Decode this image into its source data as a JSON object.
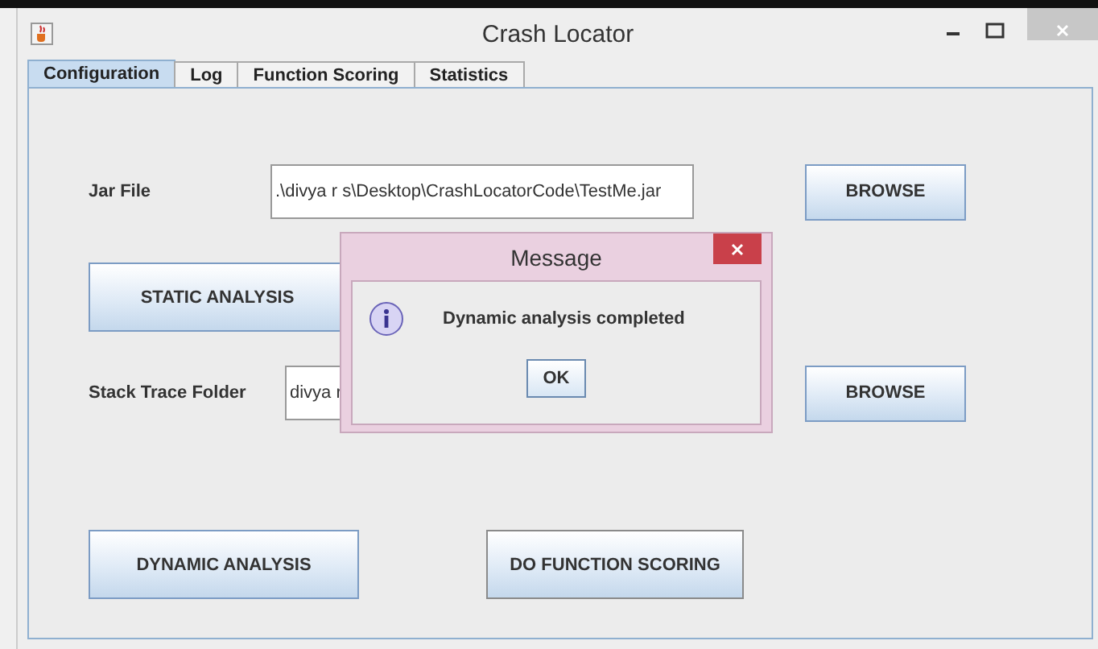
{
  "window": {
    "title": "Crash Locator"
  },
  "tabs": [
    {
      "label": "Configuration",
      "selected": true
    },
    {
      "label": "Log",
      "selected": false
    },
    {
      "label": "Function Scoring",
      "selected": false
    },
    {
      "label": "Statistics",
      "selected": false
    }
  ],
  "jar_file": {
    "label": "Jar File",
    "value": ".\\divya r s\\Desktop\\CrashLocatorCode\\TestMe.jar",
    "button": "BROWSE"
  },
  "static_button": "STATIC  ANALYSIS",
  "stack_trace": {
    "label": "Stack Trace Folder",
    "value": "divya r",
    "button": "BROWSE"
  },
  "dynamic_button": "DYNAMIC ANALYSIS",
  "scoring_button": "DO FUNCTION SCORING",
  "dialog": {
    "title": "Message",
    "message": "Dynamic analysis completed",
    "button": "OK"
  }
}
